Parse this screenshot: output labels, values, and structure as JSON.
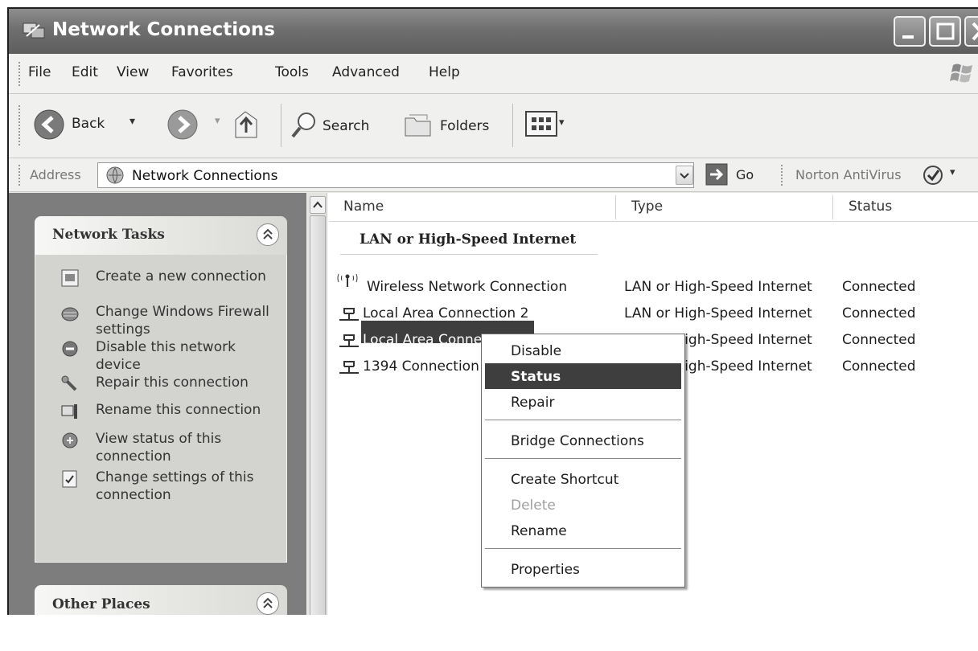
{
  "window": {
    "title": "Network Connections"
  },
  "menubar": {
    "items": [
      "File",
      "Edit",
      "View",
      "Favorites",
      "Tools",
      "Advanced",
      "Help"
    ]
  },
  "toolbar": {
    "back_label": "Back",
    "search_label": "Search",
    "folders_label": "Folders"
  },
  "addressbar": {
    "label": "Address",
    "value": "Network Connections",
    "go_label": "Go",
    "norton_label": "Norton AntiVirus"
  },
  "taskpane": {
    "network_tasks": {
      "title": "Network Tasks",
      "items": [
        {
          "label": "Create a new connection",
          "icon": "new-connection-icon"
        },
        {
          "label": "Change Windows Firewall settings",
          "icon": "firewall-icon"
        },
        {
          "label": "Disable this network device",
          "icon": "disable-device-icon"
        },
        {
          "label": "Repair this connection",
          "icon": "repair-icon"
        },
        {
          "label": "Rename this connection",
          "icon": "rename-icon"
        },
        {
          "label": "View status of this connection",
          "icon": "status-icon"
        },
        {
          "label": "Change settings of this connection",
          "icon": "settings-icon"
        }
      ]
    },
    "other_places": {
      "title": "Other Places"
    }
  },
  "list": {
    "columns": [
      "Name",
      "Type",
      "Status"
    ],
    "group": "LAN or High-Speed Internet",
    "rows": [
      {
        "name": "Wireless Network Connection",
        "type": "LAN or High-Speed Internet",
        "status": "Connected",
        "icon": "wireless-icon"
      },
      {
        "name": "Local Area Connection 2",
        "type": "LAN or High-Speed Internet",
        "status": "Connected",
        "icon": "lan-icon"
      },
      {
        "name": "Local Area Connection",
        "type": "LAN or High-Speed Internet",
        "status": "Connected",
        "icon": "lan-icon"
      },
      {
        "name": "1394 Connection",
        "type": "LAN or High-Speed Internet",
        "status": "Connected",
        "icon": "lan-icon"
      }
    ],
    "selected_row": "Local Area Connection"
  },
  "context_menu": {
    "items": [
      {
        "label": "Disable",
        "state": "normal"
      },
      {
        "label": "Status",
        "state": "active"
      },
      {
        "label": "Repair",
        "state": "normal"
      },
      {
        "label": "Bridge Connections",
        "state": "normal"
      },
      {
        "label": "Create Shortcut",
        "state": "normal"
      },
      {
        "label": "Delete",
        "state": "disabled"
      },
      {
        "label": "Rename",
        "state": "normal"
      },
      {
        "label": "Properties",
        "state": "normal"
      }
    ]
  },
  "colors": {
    "selection": "#3e3e3e",
    "task_pane_bg": "#7d7d7d",
    "titlebar": "#6f6f6f"
  }
}
